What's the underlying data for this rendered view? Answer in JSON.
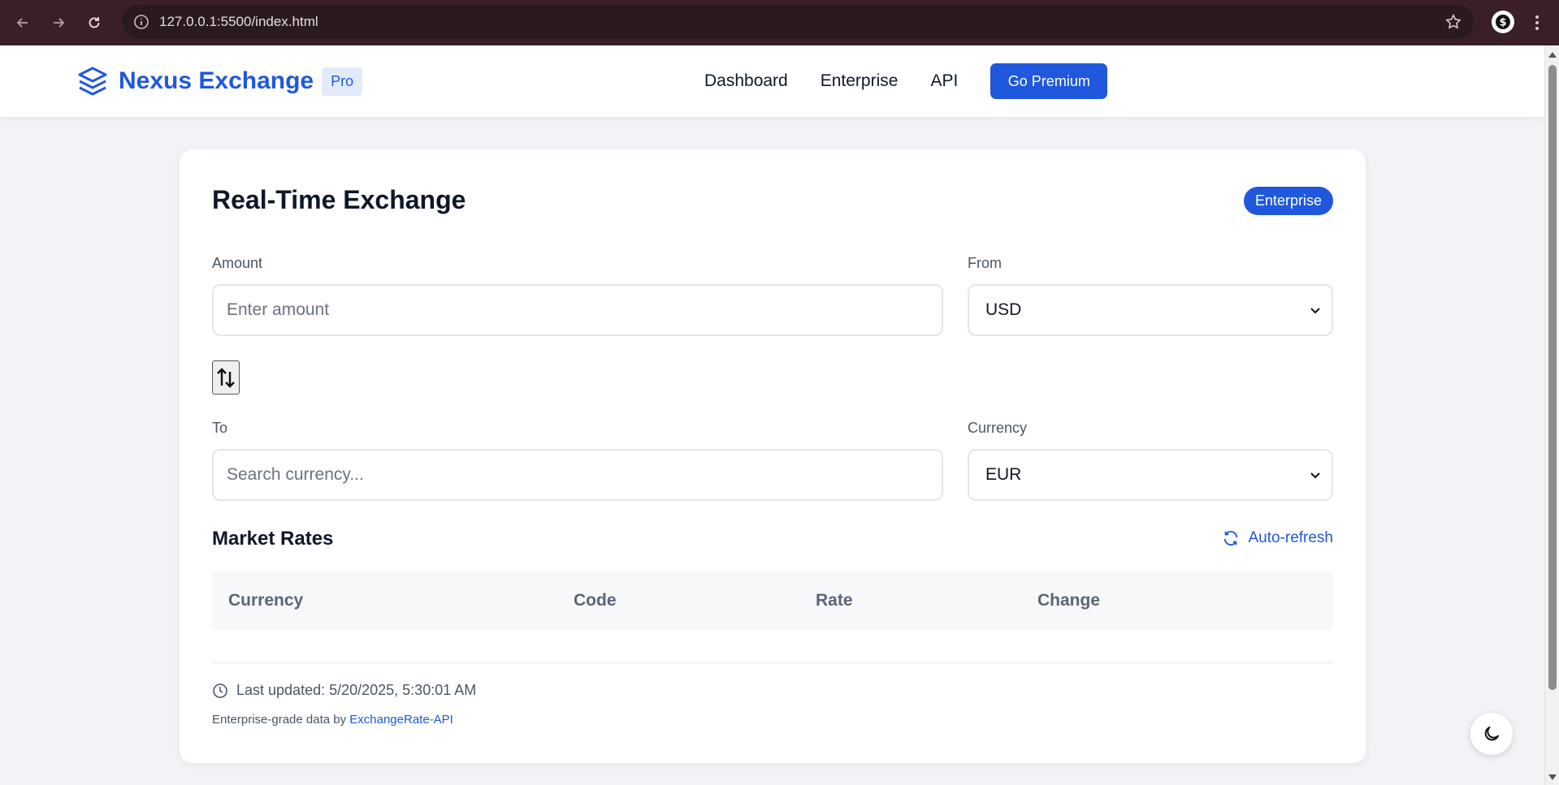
{
  "browser": {
    "url": "127.0.0.1:5500/index.html",
    "back_icon": "arrow-left-icon",
    "forward_icon": "arrow-right-icon",
    "reload_icon": "reload-icon"
  },
  "header": {
    "brand": "Nexus Exchange",
    "badge": "Pro",
    "nav": [
      "Dashboard",
      "Enterprise",
      "API"
    ],
    "cta": "Go Premium"
  },
  "card": {
    "title": "Real-Time Exchange",
    "badge": "Enterprise",
    "amount_label": "Amount",
    "amount_placeholder": "Enter amount",
    "from_label": "From",
    "from_value": "USD",
    "to_label": "To",
    "to_placeholder": "Search currency...",
    "currency_label": "Currency",
    "currency_value": "EUR"
  },
  "market": {
    "title": "Market Rates",
    "refresh_label": "Auto-refresh",
    "columns": [
      "Currency",
      "Code",
      "Rate",
      "Change"
    ]
  },
  "footer": {
    "last_updated": "Last updated: 5/20/2025, 5:30:01 AM",
    "credit_prefix": "Enterprise-grade data by ",
    "credit_link": "ExchangeRate-API"
  },
  "colors": {
    "accent": "#1f58dd",
    "chrome": "#3a1f28"
  }
}
